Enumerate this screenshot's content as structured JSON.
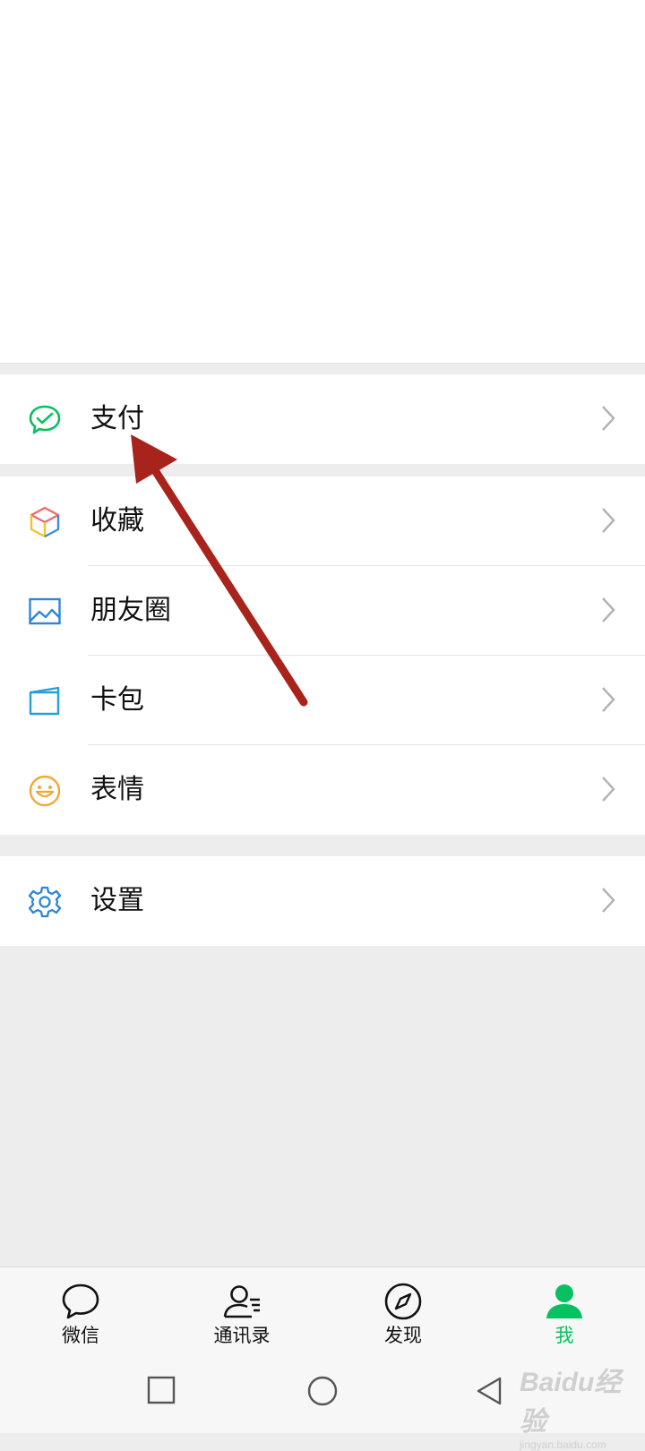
{
  "menu": {
    "pay": {
      "label": "支付",
      "icon": "wechat-pay-icon"
    },
    "favorites": {
      "label": "收藏",
      "icon": "cube-icon"
    },
    "moments": {
      "label": "朋友圈",
      "icon": "image-icon"
    },
    "cards": {
      "label": "卡包",
      "icon": "wallet-icon"
    },
    "stickers": {
      "label": "表情",
      "icon": "smiley-icon"
    },
    "settings": {
      "label": "设置",
      "icon": "gear-icon"
    }
  },
  "tabs": [
    {
      "label": "微信",
      "icon": "chat-bubble-icon"
    },
    {
      "label": "通讯录",
      "icon": "contacts-icon"
    },
    {
      "label": "发现",
      "icon": "compass-icon"
    },
    {
      "label": "我",
      "icon": "person-icon",
      "active": true
    }
  ],
  "colors": {
    "accent": "#07c160",
    "annotation": "#a8231c",
    "background": "#ededed"
  },
  "watermark": {
    "brand": "Baidu经验",
    "url": "jingyan.baidu.com"
  }
}
